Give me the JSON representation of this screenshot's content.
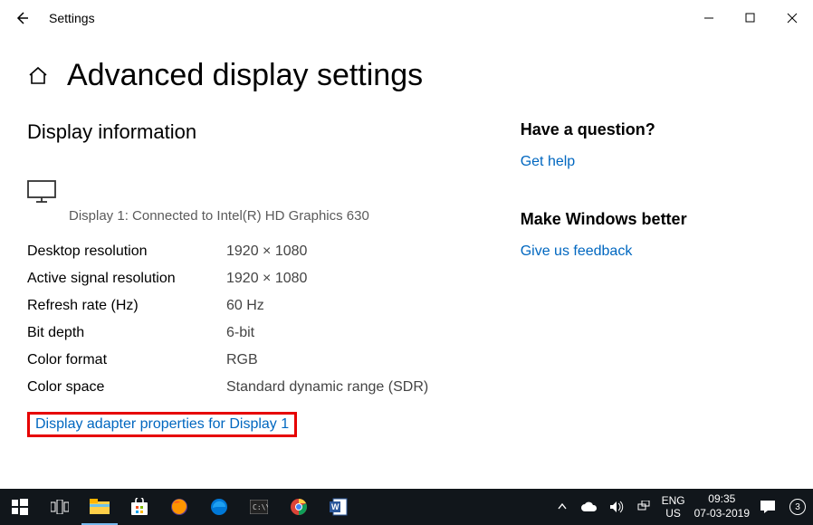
{
  "app_title": "Settings",
  "page_title": "Advanced display settings",
  "section_heading": "Display information",
  "display_subtitle": "Display 1: Connected to Intel(R) HD Graphics 630",
  "rows": [
    {
      "k": "Desktop resolution",
      "v": "1920 × 1080"
    },
    {
      "k": "Active signal resolution",
      "v": "1920 × 1080"
    },
    {
      "k": "Refresh rate (Hz)",
      "v": "60 Hz"
    },
    {
      "k": "Bit depth",
      "v": "6-bit"
    },
    {
      "k": "Color format",
      "v": "RGB"
    },
    {
      "k": "Color space",
      "v": "Standard dynamic range (SDR)"
    }
  ],
  "adapter_link": "Display adapter properties for Display 1",
  "sidebar": {
    "question_heading": "Have a question?",
    "help_link": "Get help",
    "better_heading": "Make Windows better",
    "feedback_link": "Give us feedback"
  },
  "taskbar": {
    "lang_top": "ENG",
    "lang_bot": "US",
    "clock_time": "09:35",
    "clock_date": "07-03-2019",
    "notif_count": "3"
  }
}
